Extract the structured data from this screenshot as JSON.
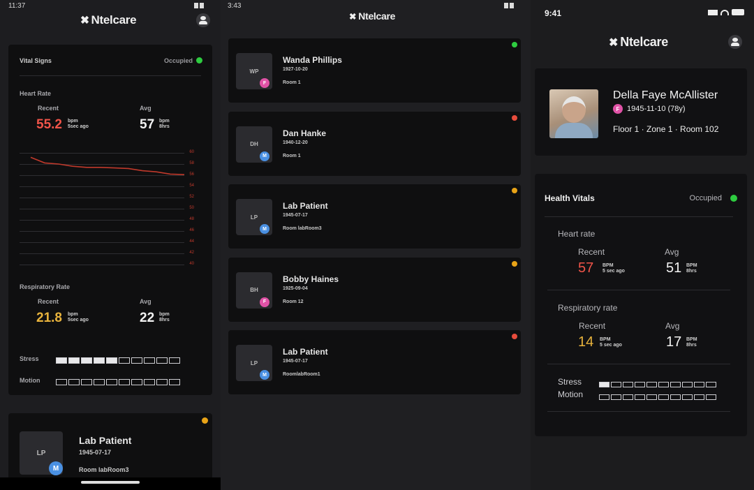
{
  "left": {
    "status_time": "11:37",
    "brand": "Ntelcare",
    "vitals_title": "Vital Signs",
    "occupied": "Occupied",
    "heart_label": "Heart Rate",
    "recent_label": "Recent",
    "avg_label": "Avg",
    "heart_recent": "55.2",
    "heart_avg": "57",
    "unit_bpm": "bpm",
    "ago": "5sec ago",
    "hrs": "8hrs",
    "y_ticks": [
      "60",
      "58",
      "56",
      "54",
      "52",
      "50",
      "48",
      "46",
      "44",
      "42",
      "40"
    ],
    "resp_label": "Respiratory Rate",
    "resp_recent": "21.8",
    "resp_avg": "22",
    "stress_label": "Stress",
    "motion_label": "Motion",
    "stress_level": 0.5,
    "motion_level": 0,
    "card2_initials": "LP",
    "card2_sex": "M",
    "card2_name": "Lab Patient",
    "card2_dob": "1945-07-17",
    "card2_room": "Room labRoom3",
    "heart_line": [
      59.2,
      58.2,
      58.0,
      57.6,
      57.4,
      57.4,
      57.3,
      57.2,
      56.8,
      56.6,
      56.2,
      56.1
    ]
  },
  "middle": {
    "status_time": "3:43",
    "brand": "Ntelcare",
    "patients": [
      {
        "initials": "WP",
        "sex": "F",
        "name": "Wanda Phillips",
        "dob": "1927-10-20",
        "room": "Room 1",
        "status": "#2ecc40"
      },
      {
        "initials": "DH",
        "sex": "M",
        "name": "Dan Hanke",
        "dob": "1940-12-20",
        "room": "Room 1",
        "status": "#e74c3c"
      },
      {
        "initials": "LP",
        "sex": "M",
        "name": "Lab Patient",
        "dob": "1945-07-17",
        "room": "Room labRoom3",
        "status": "#e8a317"
      },
      {
        "initials": "BH",
        "sex": "F",
        "name": "Bobby Haines",
        "dob": "1925-09-04",
        "room": "Room 12",
        "status": "#e8a317"
      },
      {
        "initials": "LP",
        "sex": "M",
        "name": "Lab Patient",
        "dob": "1945-07-17",
        "room": "RoomlabRoom1",
        "status": "#e74c3c"
      }
    ]
  },
  "right": {
    "status_time": "9:41",
    "brand": "Ntelcare",
    "patient_name": "Della Faye McAllister",
    "sex": "F",
    "dob": "1945-11-10 (78y)",
    "location": "Floor 1 · Zone 1 · Room 102",
    "vitals_title": "Health Vitals",
    "occupied": "Occupied",
    "heart_label": "Heart rate",
    "recent_label": "Recent",
    "avg_label": "Avg",
    "heart_recent": "57",
    "heart_avg": "51",
    "resp_label": "Respiratory rate",
    "resp_recent": "14",
    "resp_avg": "17",
    "unit": "BPM",
    "ago": "5 sec ago",
    "hrs": "8hrs",
    "stress_label": "Stress",
    "motion_label": "Motion",
    "stress_level": 0.1,
    "motion_level": 0
  }
}
